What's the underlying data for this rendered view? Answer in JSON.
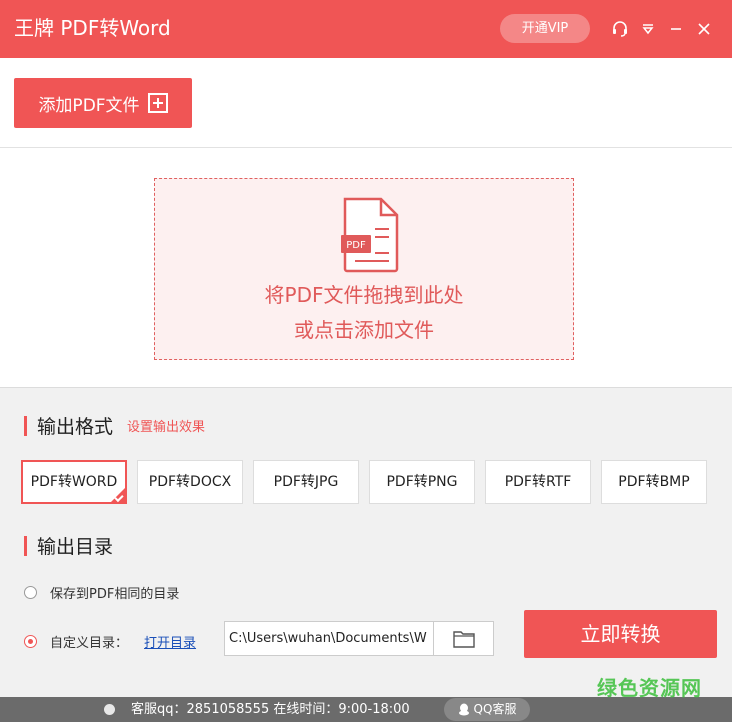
{
  "titlebar": {
    "title": "王牌 PDF转Word",
    "vip_label": "开通VIP",
    "icons": [
      "headset-icon",
      "dropdown-menu-icon",
      "minimize-icon",
      "close-icon"
    ]
  },
  "toolbar": {
    "add_label": "添加PDF文件"
  },
  "drop_zone": {
    "badge": "PDF",
    "line1": "将PDF文件拖拽到此处",
    "line2": "或点击添加文件"
  },
  "output_format": {
    "title": "输出格式",
    "settings_link": "设置输出效果",
    "selected": 0,
    "options": [
      "PDF转WORD",
      "PDF转DOCX",
      "PDF转JPG",
      "PDF转PNG",
      "PDF转RTF",
      "PDF转BMP"
    ]
  },
  "output_dir": {
    "title": "输出目录",
    "option_same": "保存到PDF相同的目录",
    "option_custom": "自定义目录：",
    "open_dir": "打开目录",
    "path": "C:\\Users\\wuhan\\Documents\\W",
    "selected": "custom"
  },
  "convert_label": "立即转换",
  "footer": {
    "service": "客服qq：2851058555 在线时间：9:00-18:00",
    "qq_label": "QQ客服"
  },
  "watermark": "绿色资源网",
  "colors": {
    "accent": "#f05555",
    "vip_bg": "#f48787",
    "footer_bg": "#6b6b6b",
    "watermark": "#3bbf3b"
  }
}
